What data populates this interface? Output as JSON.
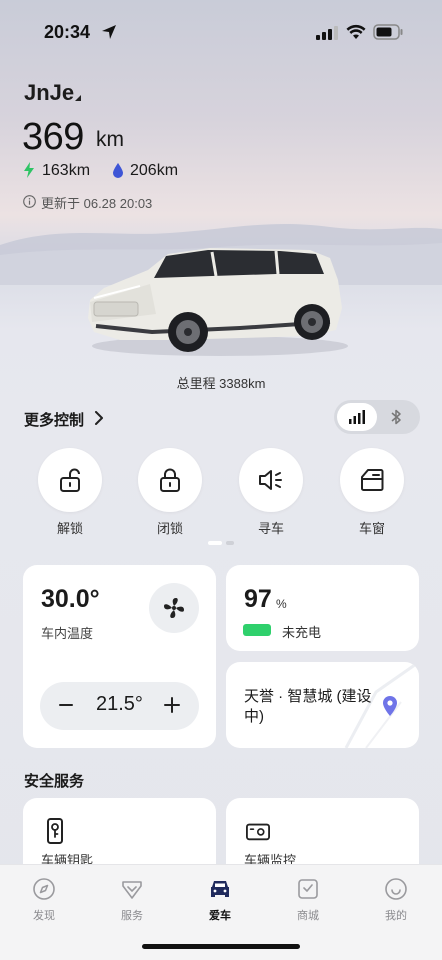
{
  "status_bar": {
    "time": "20:34"
  },
  "vehicle": {
    "name": "JnJe",
    "range_value": "369",
    "range_unit": "km",
    "electric_range": "163km",
    "fuel_range": "206km",
    "updated": "更新于 06.28 20:03",
    "odometer": "总里程 3388km"
  },
  "controls": {
    "more_label": "更多控制",
    "buttons": [
      {
        "label": "解锁",
        "icon": "unlock-icon"
      },
      {
        "label": "闭锁",
        "icon": "lock-icon"
      },
      {
        "label": "寻车",
        "icon": "find-car-icon"
      },
      {
        "label": "车窗",
        "icon": "window-icon"
      }
    ]
  },
  "climate": {
    "interior_temp": "30.0°",
    "interior_label": "车内温度",
    "set_temp": "21.5°"
  },
  "battery": {
    "soc": "97",
    "soc_unit": "%",
    "soc_fraction": 0.97,
    "charge_status": "未充电",
    "bar_color": "#2fd06c"
  },
  "location": {
    "text": "天誉 · 智慧城 (建设中)"
  },
  "safety": {
    "title": "安全服务",
    "items": [
      {
        "label": "车辆钥匙",
        "icon": "car-key-icon"
      },
      {
        "label": "车辆监控",
        "icon": "camera-monitor-icon"
      }
    ]
  },
  "tabs": [
    {
      "label": "发现",
      "icon": "compass-icon",
      "active": false
    },
    {
      "label": "服务",
      "icon": "heart-service-icon",
      "active": false
    },
    {
      "label": "爱车",
      "icon": "car-icon",
      "active": true
    },
    {
      "label": "商城",
      "icon": "shop-bag-icon",
      "active": false
    },
    {
      "label": "我的",
      "icon": "profile-icon",
      "active": false
    }
  ]
}
